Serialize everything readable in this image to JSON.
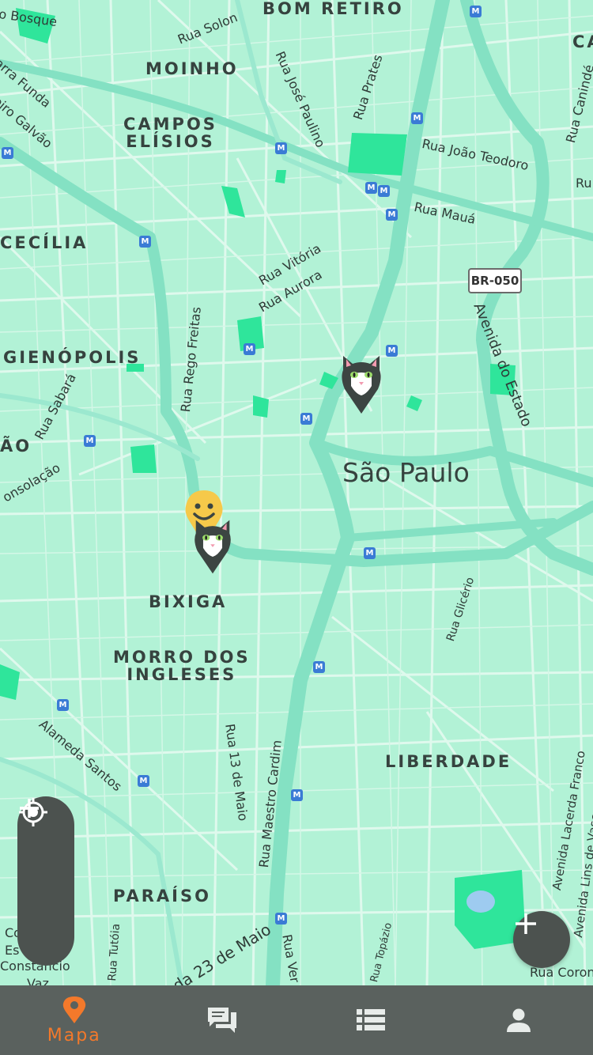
{
  "map": {
    "city_label": "São Paulo",
    "highway_shield": "BR-050",
    "districts": [
      {
        "id": "bom-retiro",
        "text": "BOM RETIRO"
      },
      {
        "id": "moinho",
        "text": "MOINHO"
      },
      {
        "id": "campos-eliseos",
        "text": "CAMPOS\nELÍSIOS"
      },
      {
        "id": "cecilia",
        "text": "CECÍLIA"
      },
      {
        "id": "higienopolis",
        "text": "GIENÓPOLIS"
      },
      {
        "id": "ao",
        "text": "ÃO"
      },
      {
        "id": "bixiga",
        "text": "BIXIGA"
      },
      {
        "id": "morro-dos-ingleses",
        "text": "MORRO DOS\nINGLESES"
      },
      {
        "id": "liberdade",
        "text": "LIBERDADE"
      },
      {
        "id": "paraiso",
        "text": "PARAÍSO"
      }
    ],
    "streets": [
      {
        "id": "bosque",
        "text": "o Bosque"
      },
      {
        "id": "solon",
        "text": "Rua Solon"
      },
      {
        "id": "barra-funda",
        "text": "arra Funda"
      },
      {
        "id": "galvao",
        "text": "eiro Galvão"
      },
      {
        "id": "jose-paulino",
        "text": "Rua José Paulino"
      },
      {
        "id": "prates",
        "text": "Rua Prates"
      },
      {
        "id": "joao-teodoro",
        "text": "Rua João Teodoro"
      },
      {
        "id": "maua",
        "text": "Rua Mauá"
      },
      {
        "id": "caninde",
        "text": "Rua Canindé"
      },
      {
        "id": "ru-right",
        "text": "Ru"
      },
      {
        "id": "ca-right",
        "text": "CA"
      },
      {
        "id": "vitoria",
        "text": "Rua Vitória"
      },
      {
        "id": "aurora",
        "text": "Rua Aurora"
      },
      {
        "id": "rego-freitas",
        "text": "Rua Rego Freitas"
      },
      {
        "id": "sabara",
        "text": "Rua Sabará"
      },
      {
        "id": "consolacao",
        "text": "onsolação"
      },
      {
        "id": "av-estado",
        "text": "Avenida do Estado"
      },
      {
        "id": "glicerio",
        "text": "Rua Glicério"
      },
      {
        "id": "alameda-santos",
        "text": "Alameda Santos"
      },
      {
        "id": "treze-maio",
        "text": "Rua 13 de Maio"
      },
      {
        "id": "maestro-cardim",
        "text": "Rua Maestro Cardim"
      },
      {
        "id": "lacerda-franco",
        "text": "Avenida Lacerda Franco"
      },
      {
        "id": "lins-vasconcelos",
        "text": "Avenida Lins de Vasco"
      },
      {
        "id": "tutoia",
        "text": "Rua Tutóia"
      },
      {
        "id": "vinte-tres-maio",
        "text": "da 23 de Maio"
      },
      {
        "id": "vergueiro",
        "text": "Rua Ver"
      },
      {
        "id": "topazio",
        "text": "Rua Topázio"
      },
      {
        "id": "coronel",
        "text": "Rua Coron"
      },
      {
        "id": "constancio",
        "text": "Constancio"
      },
      {
        "id": "es",
        "text": "Es"
      },
      {
        "id": "co",
        "text": "Co"
      },
      {
        "id": "vaz",
        "text": "Vaz"
      }
    ],
    "metro_symbol": "M"
  },
  "controls": {
    "locate_icon": "crosshair-icon",
    "zoom_in_icon": "plus-icon",
    "zoom_out_icon": "minus-icon",
    "add_icon": "plus-icon"
  },
  "nav": {
    "tabs": [
      {
        "id": "mapa",
        "label": "Mapa",
        "icon": "map-pin-icon",
        "active": true
      },
      {
        "id": "chat",
        "label": "",
        "icon": "chat-icon",
        "active": false
      },
      {
        "id": "list",
        "label": "",
        "icon": "list-icon",
        "active": false
      },
      {
        "id": "profile",
        "label": "",
        "icon": "person-icon",
        "active": false
      }
    ]
  },
  "colors": {
    "map_background": "#b2f2d6",
    "major_road": "#7fdfc0",
    "minor_road": "#e6fbf2",
    "park": "#2ee89a",
    "nav_background": "#5a615e",
    "active_accent": "#f3792b",
    "control_background": "#4c524f",
    "pet_pin": "#3c4542",
    "person_pin": "#f6c94a"
  }
}
